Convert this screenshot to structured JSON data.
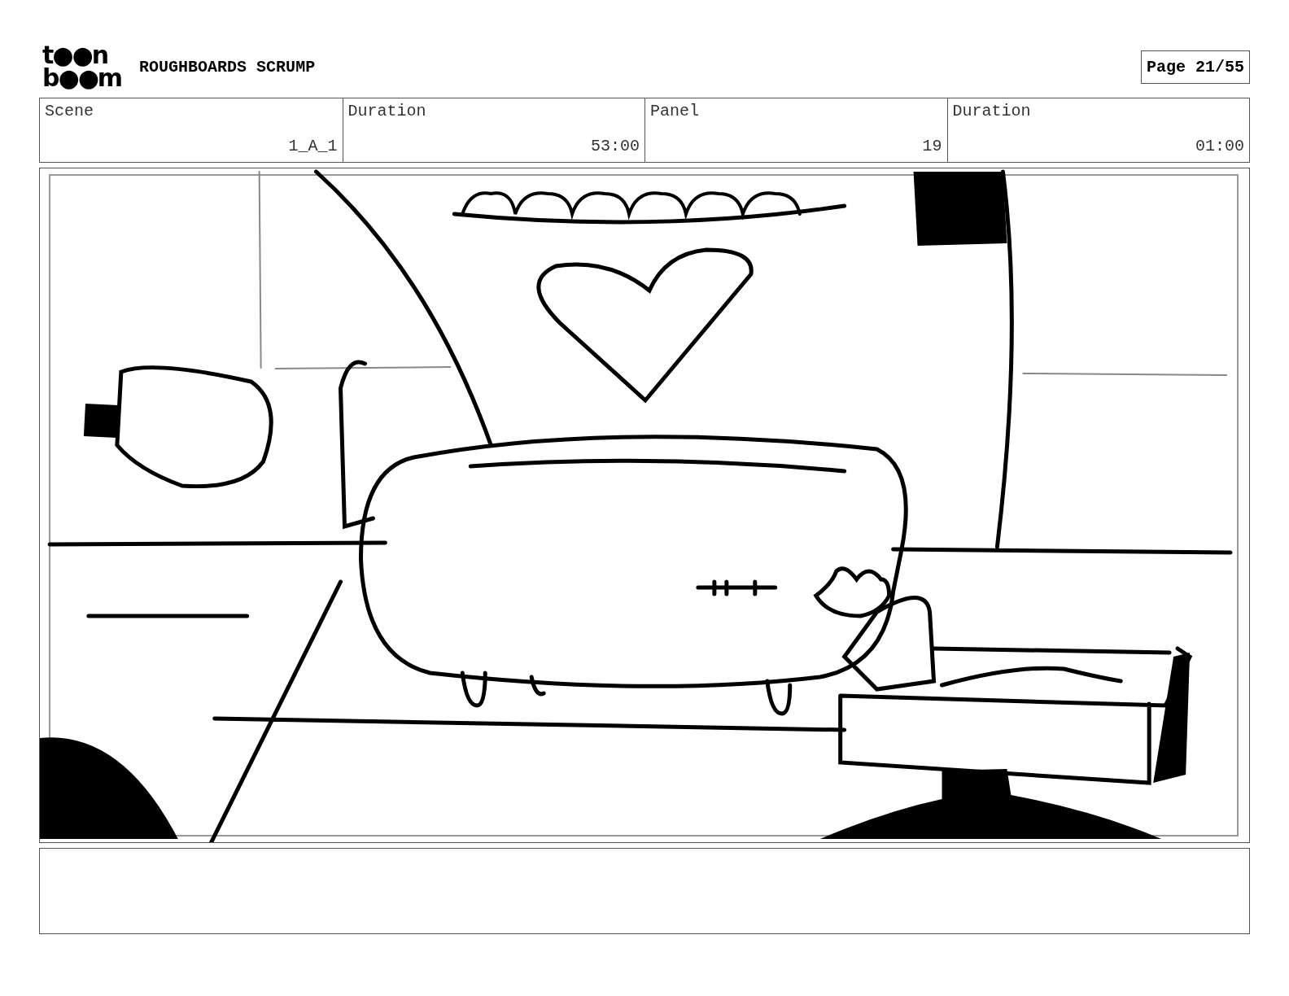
{
  "logo": {
    "top": "t●●n",
    "bottom": "b●●m"
  },
  "title": "ROUGHBOARDS SCRUMP",
  "page": "Page 21/55",
  "field_labels": [
    "Scene",
    "Duration",
    "Panel",
    "Duration"
  ],
  "field_values": [
    "1_A_1",
    "53:00",
    "19",
    "01:00"
  ],
  "panel": {
    "kind": "drawing"
  }
}
